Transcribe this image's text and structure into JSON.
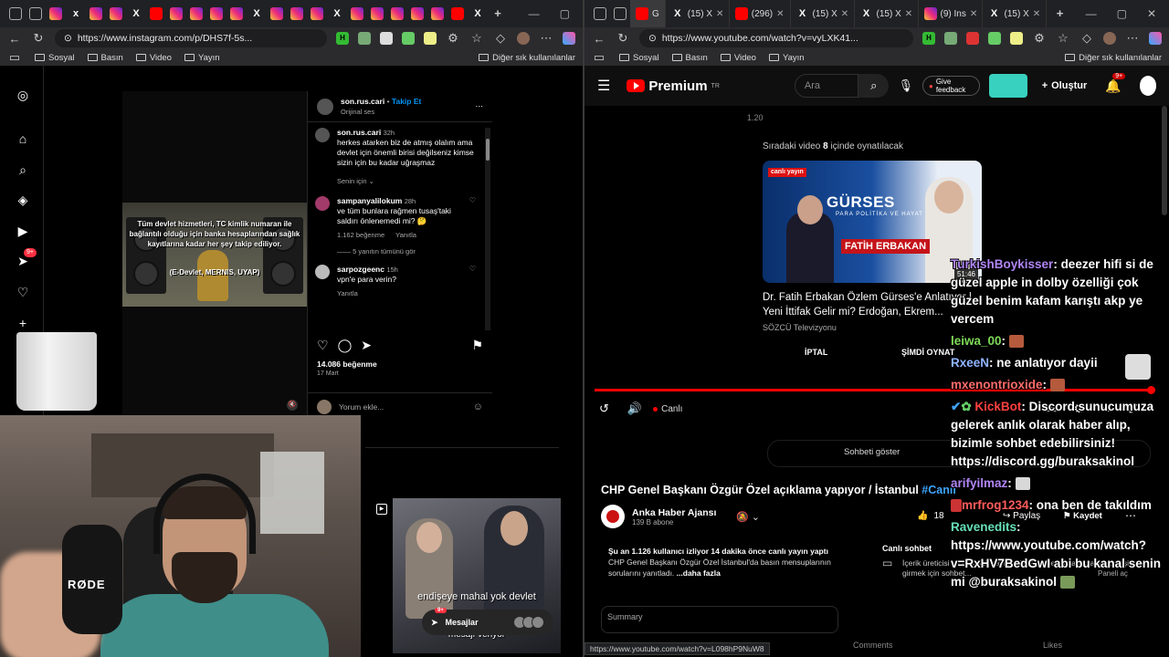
{
  "left_browser": {
    "url": "https://www.instagram.com/p/DHS7f-5s...",
    "bookmarks": [
      "Sosyal",
      "Basın",
      "Video",
      "Yayın"
    ],
    "bookmarks_right": "Diğer sık kullanılanlar",
    "tabs": [
      "x"
    ]
  },
  "right_browser": {
    "url": "https://www.youtube.com/watch?v=vyLXK41...",
    "bookmarks": [
      "Sosyal",
      "Basın",
      "Video",
      "Yayın"
    ],
    "bookmarks_right": "Diğer sık kullanılanlar",
    "tabs": [
      "G",
      "(15) X",
      "(296)",
      "(15) X",
      "(15) X",
      "(9) Ins",
      "(15) X"
    ]
  },
  "instagram": {
    "badge_notifications": "9+",
    "post": {
      "username": "son.rus.cari",
      "follow": "Takip Et",
      "audio": "Orijinal ses",
      "video_caption": "Tüm devlet hizmetleri, TC kimlik numaran ile bağlantılı olduğu için banka hesaplarından sağlık kayıtlarına kadar her şey takip ediliyor.",
      "video_caption2": "(E-Devlet, MERNIS, UYAP)",
      "author_comment": {
        "username": "son.rus.cari",
        "time": "32h",
        "text": "herkes atarken biz de atmış olalım ama devlet için önemli birisi değilseniz kimse sizin için bu kadar uğraşmaz"
      },
      "for_you": "Senin için",
      "comments": [
        {
          "username": "sampanyalilokum",
          "time": "28h",
          "text": "ve tüm bunlara rağmen tusaş'taki saldırı önlenemedi mi? 🤔",
          "likes": "1.162 beğenme",
          "reply": "Yanıtla",
          "view_replies": "5 yanıtın tümünü gör"
        },
        {
          "username": "sarpozgeenc",
          "time": "15h",
          "text": "vpn'e para verin?",
          "reply": "Yanıtla"
        }
      ],
      "likes": "14.086 beğenme",
      "date": "17 Mart",
      "comment_placeholder": "Yorum ekle..."
    },
    "second_post": {
      "caption": "endişeye mahal yok devlet",
      "caption2": "mesajı veriyor"
    },
    "messages": {
      "label": "Mesajlar",
      "badge": "9+"
    }
  },
  "webcam": {
    "mic_label": "RØDE"
  },
  "youtube": {
    "logo": "Premium",
    "logo_region": "TR",
    "search_placeholder": "Ara",
    "feedback": "Give feedback",
    "create": "Oluştur",
    "bell_badge": "9+",
    "player": {
      "time_small": "1.20",
      "upnext_prefix": "Sıradaki video ",
      "upnext_count": "8",
      "upnext_suffix": " içinde oynatılacak",
      "next_thumb_title": "GÜRSES",
      "next_thumb_sub": "PARA POLİTİKA VE HAYAT",
      "next_thumb_name": "FATİH ERBAKAN",
      "next_thumb_badge": "canlı yayın",
      "next_thumb_dur": "51:46",
      "next_title": "Dr. Fatih Erbakan Özlem Gürses'e Anlatıyor | Yeni İttifak Gelir mi? Erdoğan, Ekrem...",
      "next_channel": "SÖZCÜ Televizyonu",
      "cancel": "İPTAL",
      "play_now": "ŞİMDİ OYNAT",
      "live": "Canlı"
    },
    "show_chat": "Sohbeti göster",
    "video": {
      "title": "CHP Genel Başkanı Özgür Özel açıklama yapıyor / İstanbul ",
      "title_tag": "#Canlı",
      "channel": "Anka Haber Ajansı",
      "subs": "139 B abone",
      "likes": "18",
      "share": "Paylaş",
      "save": "Kaydet",
      "desc_stats": "Şu an 1.126 kullanıcı izliyor  14 dakika önce canlı yayın yaptı",
      "desc_text": "CHP Genel Başkanı Özgür Özel İstanbul'da basın mensuplarının sorularını yanıtladı.",
      "desc_more": "...daha fazla",
      "live_chat_title": "Canlı sohbet",
      "live_chat_text": "İçerik üreticisi ve bu canlı yayını izleyen diğer kullanıcılarla etkileşime girmek için sohbet...",
      "open_panel": "Paneli aç",
      "summary": "Summary",
      "comments": "Comments",
      "likes_label": "Likes"
    },
    "status_url": "https://www.youtube.com/watch?v=L098hP9NuW8"
  },
  "stream_chat": [
    {
      "user": "TurkishBoykisser",
      "text": "deezer hifi si de güzel apple in dolby özelliği çok güzel benim kafam karıştı akp ye vercem"
    },
    {
      "user": "leiwa_00",
      "text": ""
    },
    {
      "user": "RxeeN",
      "text": "ne anlatıyor dayii"
    },
    {
      "user": "mxenontrioxide",
      "text": ""
    },
    {
      "user": "KickBot",
      "text": "Discord sunucumuza gelerek anlık olarak haber alıp, bizimle sohbet edebilirsiniz! https://discord.gg/buraksakinol"
    },
    {
      "user": "arifyilmaz",
      "text": ""
    },
    {
      "user": "mrfrog1234",
      "text": "ona ben de takıldım"
    },
    {
      "user": "Ravenedits",
      "text": "https://www.youtube.com/watch?v=RxHV7BedGwI abi bu kanal senin mi @buraksakinol"
    }
  ]
}
